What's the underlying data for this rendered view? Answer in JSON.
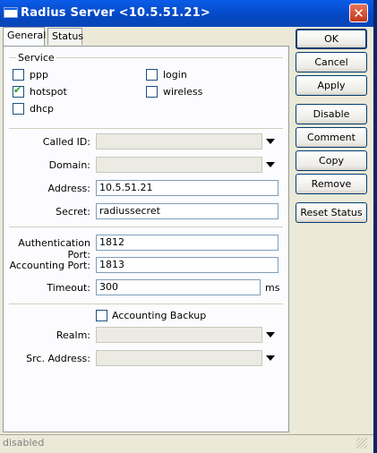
{
  "window": {
    "title": "Radius Server <10.5.51.21>",
    "close_glyph": "✕"
  },
  "tabs": [
    {
      "label": "General"
    },
    {
      "label": "Status"
    }
  ],
  "service": {
    "label": "Service",
    "options": [
      {
        "label": "ppp",
        "checked": false
      },
      {
        "label": "hotspot",
        "checked": true
      },
      {
        "label": "dhcp",
        "checked": false
      },
      {
        "label": "login",
        "checked": false
      },
      {
        "label": "wireless",
        "checked": false
      }
    ]
  },
  "fields": {
    "called_id": {
      "label": "Called ID:",
      "value": ""
    },
    "domain": {
      "label": "Domain:",
      "value": ""
    },
    "address": {
      "label": "Address:",
      "value": "10.5.51.21"
    },
    "secret": {
      "label": "Secret:",
      "value": "radiussecret"
    },
    "auth_port": {
      "label": "Authentication Port:",
      "value": "1812"
    },
    "acct_port": {
      "label": "Accounting Port:",
      "value": "1813"
    },
    "timeout": {
      "label": "Timeout:",
      "value": "300",
      "unit": "ms"
    },
    "accounting_backup": {
      "label": "Accounting Backup",
      "checked": false
    },
    "realm": {
      "label": "Realm:",
      "value": ""
    },
    "src_address": {
      "label": "Src. Address:",
      "value": ""
    }
  },
  "buttons": {
    "ok": "OK",
    "cancel": "Cancel",
    "apply": "Apply",
    "disable": "Disable",
    "comment": "Comment",
    "copy": "Copy",
    "remove": "Remove",
    "reset_status": "Reset Status"
  },
  "status": {
    "text": "disabled"
  }
}
